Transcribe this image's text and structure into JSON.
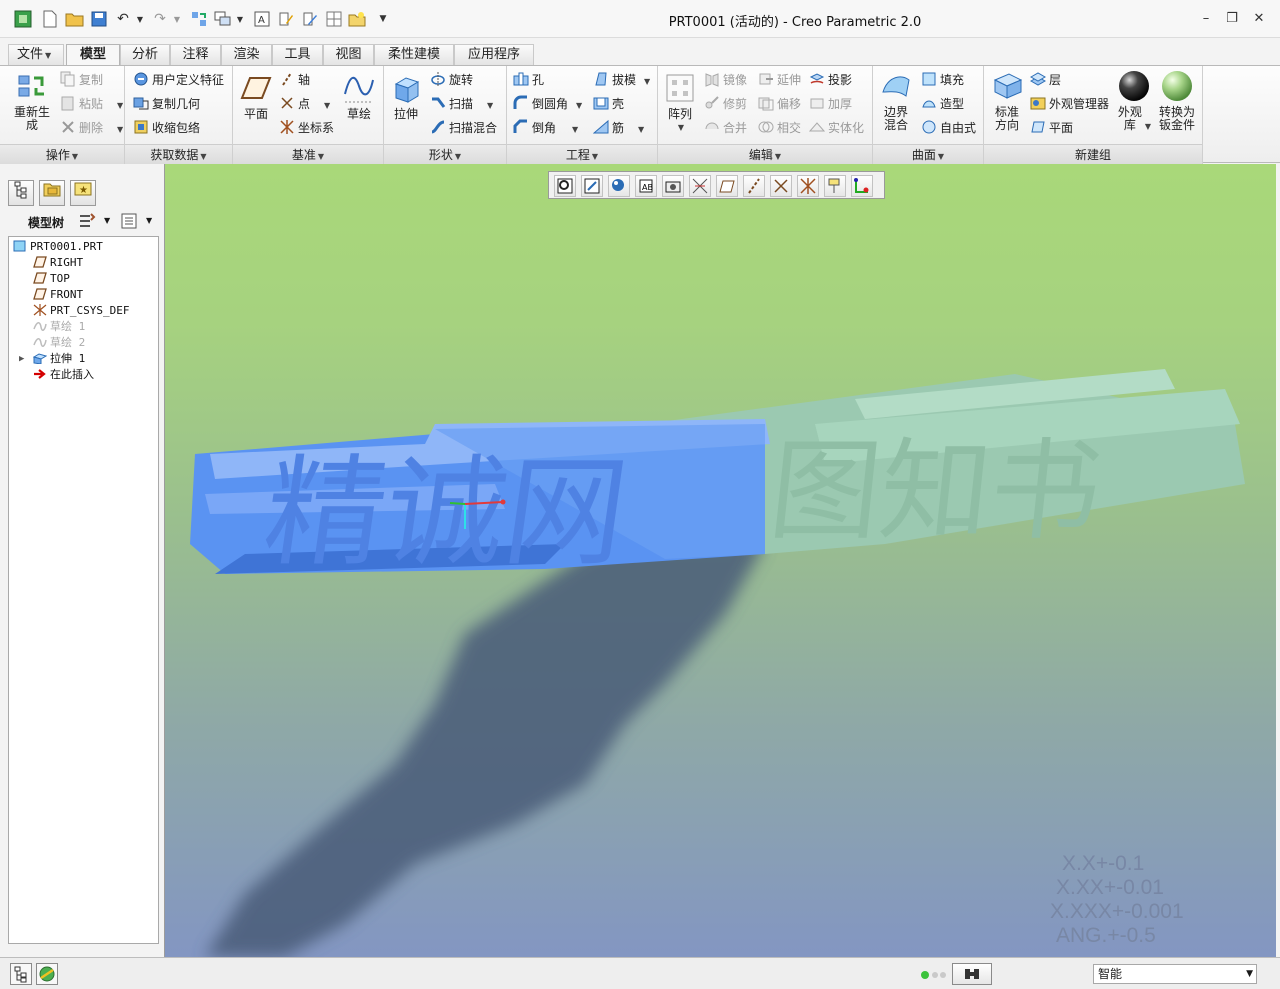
{
  "window": {
    "title": "PRT0001 (活动的) - Creo Parametric 2.0",
    "minimize": "–",
    "restore": "❐",
    "close": "✕"
  },
  "tabs": [
    "文件",
    "模型",
    "分析",
    "注释",
    "渲染",
    "工具",
    "视图",
    "柔性建模",
    "应用程序"
  ],
  "active_tab": "模型",
  "ribbon": {
    "operations": {
      "regenerate_label": "重新生成",
      "copy": "复制",
      "paste": "粘贴",
      "delete": "删除",
      "group_label": "操作"
    },
    "get_data": {
      "udf": "用户定义特征",
      "copy_geom": "复制几何",
      "shrinkwrap": "收缩包络",
      "group_label": "获取数据"
    },
    "datum": {
      "plane": "平面",
      "axis": "轴",
      "point": "点",
      "csys": "坐标系",
      "sketch": "草绘",
      "group_label": "基准"
    },
    "shapes": {
      "extrude": "拉伸",
      "revolve": "旋转",
      "sweep": "扫描",
      "swept_blend": "扫描混合",
      "group_label": "形状"
    },
    "engineering": {
      "hole": "孔",
      "round": "倒圆角",
      "chamfer": "倒角",
      "draft": "拔模",
      "shell": "壳",
      "rib": "筋",
      "group_label": "工程"
    },
    "editing": {
      "pattern": "阵列",
      "mirror": "镜像",
      "trim": "修剪",
      "merge": "合并",
      "extend": "延伸",
      "offset": "偏移",
      "intersect": "相交",
      "project": "投影",
      "thicken": "加厚",
      "solidify": "实体化",
      "group_label": "编辑"
    },
    "surfaces": {
      "boundary_blend": "边界混合",
      "fill": "填充",
      "style": "造型",
      "freestyle": "自由式",
      "group_label": "曲面"
    },
    "new_group": {
      "standard_orient": "标准方向",
      "layer": "层",
      "appearance_mgr": "外观管理器",
      "plane": "平面",
      "appearance_lib": "外观库",
      "convert_sheetmetal": "转换为钣金件",
      "group_label": "新建组"
    }
  },
  "left_panel": {
    "tree_label": "模型树",
    "items": [
      {
        "label": "PRT0001.PRT",
        "icon": "part-icon",
        "dim": false
      },
      {
        "label": "RIGHT",
        "icon": "datum-plane-icon",
        "dim": false
      },
      {
        "label": "TOP",
        "icon": "datum-plane-icon",
        "dim": false
      },
      {
        "label": "FRONT",
        "icon": "datum-plane-icon",
        "dim": false
      },
      {
        "label": "PRT_CSYS_DEF",
        "icon": "csys-icon",
        "dim": false
      },
      {
        "label": "草绘 1",
        "icon": "sketch-icon",
        "dim": true
      },
      {
        "label": "草绘 2",
        "icon": "sketch-icon",
        "dim": true
      },
      {
        "label": "拉伸 1",
        "icon": "extrude-icon",
        "dim": false
      },
      {
        "label": "在此插入",
        "icon": "insert-here-icon",
        "dim": false
      }
    ]
  },
  "viewport": {
    "tolerances": [
      "X.X+-0.1",
      "X.XX+-0.01",
      "X.XXX+-0.001",
      "ANG.+-0.5"
    ],
    "model_text": "精诚网",
    "shadow_text": "图知书"
  },
  "status_bar": {
    "selection_filter": "智能"
  },
  "colors": {
    "viewport_top": "#a9d879",
    "viewport_bottom": "#8396c2",
    "model_blue": "#5f97f5",
    "model_green": "#93c6a7"
  }
}
